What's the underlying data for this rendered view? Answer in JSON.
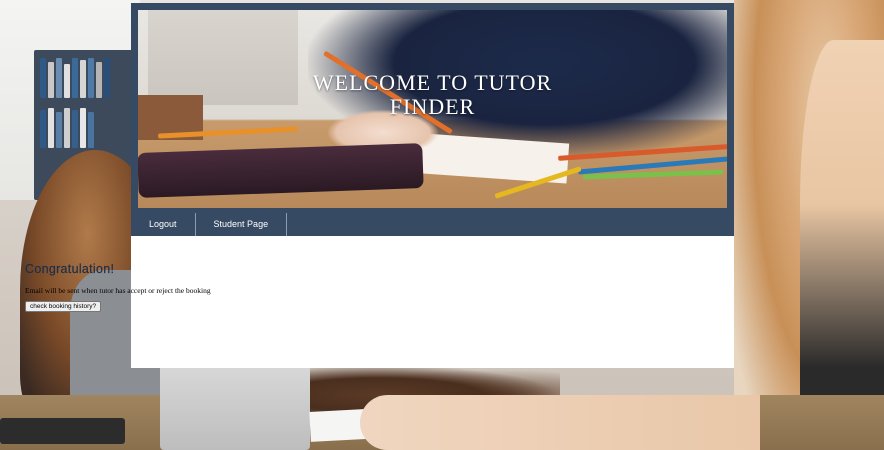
{
  "banner": {
    "title": "WELCOME TO TUTOR FINDER"
  },
  "nav": {
    "items": [
      {
        "label": "Logout"
      },
      {
        "label": "Student Page"
      }
    ]
  },
  "main": {
    "heading": "Congratulation!",
    "message": "Email will be sent when tutor has accept or reject the booking",
    "history_button": "check booking history?"
  },
  "colors": {
    "nav_bar": "#374a63",
    "heading": "#1f2f4a",
    "content_bg": "#ffffff"
  }
}
